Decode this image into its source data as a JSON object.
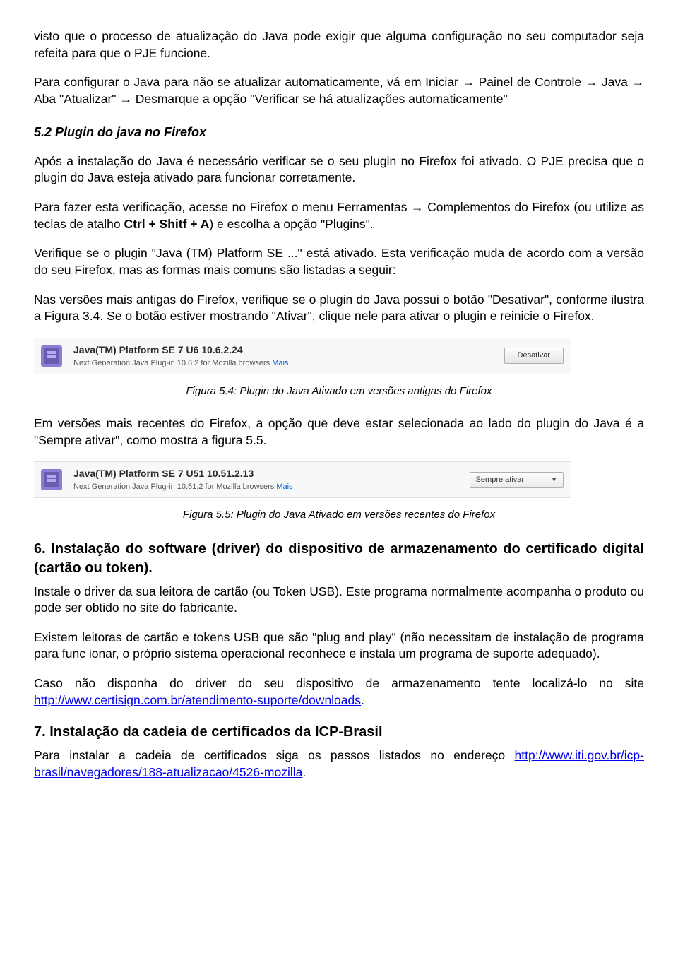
{
  "para1": "visto que o processo de atualização do Java pode exigir que alguma configuração no seu computador seja refeita para que o PJE funcione.",
  "para2": "Para configurar o Java para não se atualizar automaticamente, vá em Iniciar → Painel de Controle → Java → Aba \"Atualizar\" → Desmarque a opção \"Verificar se há atualizações automaticamente\"",
  "heading52": "5.2 Plugin do java no Firefox",
  "para3": "Após a instalação do Java é necessário verificar se o seu plugin no Firefox foi ativado. O PJE precisa que o plugin do Java esteja ativado para funcionar corretamente.",
  "para4_a": "Para fazer esta verificação, acesse no Firefox o menu Ferramentas → Complementos do Firefox (ou utilize as teclas de atalho ",
  "para4_b": "Ctrl + Shitf + A",
  "para4_c": ") e escolha a opção \"Plugins\".",
  "para5": "Verifique se o plugin \"Java (TM) Platform SE ...\" está ativado. Esta verificação muda de acordo com a versão do seu Firefox, mas as formas mais comuns são listadas a seguir:",
  "para6": "Nas versões mais antigas do Firefox, verifique se o plugin do Java possui o botão \"Desativar\", conforme ilustra a Figura 3.4. Se o botão estiver mostrando \"Ativar\", clique nele para ativar o plugin e reinicie o Firefox.",
  "plugin1": {
    "title": "Java(TM) Platform SE 7 U6  10.6.2.24",
    "sub": "Next Generation Java Plug-in 10.6.2 for Mozilla browsers  ",
    "more": "Mais",
    "button": "Desativar"
  },
  "caption54": "Figura 5.4: Plugin do Java Ativado em versões antigas do Firefox",
  "para7": "Em versões mais recentes do Firefox, a opção que deve estar selecionada ao lado do plugin do Java é a \"Sempre ativar\", como mostra a figura 5.5.",
  "plugin2": {
    "title": "Java(TM) Platform SE 7 U51  10.51.2.13",
    "sub": "Next Generation Java Plug-in 10.51.2 for Mozilla browsers  ",
    "more": "Mais",
    "select": "Sempre ativar"
  },
  "caption55": "Figura 5.5: Plugin do Java Ativado em versões recentes do Firefox",
  "heading6": "6.    Instalação do software (driver) do dispositivo de armazenamento do certificado digital (cartão ou token).",
  "para8": "Instale o driver da sua leitora de cartão (ou Token USB). Este programa normalmente acompanha o produto ou pode ser obtido no site do fabricante.",
  "para9": "Existem leitoras de cartão e tokens USB que são \"plug and play\" (não necessitam de instalação de programa para func ionar, o próprio sistema operacional reconhece e instala um programa de suporte adequado).",
  "para10_a": "Caso não disponha do driver do seu dispositivo de armazenamento tente localizá-lo no site ",
  "para10_link": "http://www.certisign.com.br/atendimento-suporte/downloads",
  "para10_b": ".",
  "heading7": "7.    Instalação da cadeia de certificados da ICP-Brasil",
  "para11_a": "Para instalar a cadeia de certificados siga os passos listados no endereço ",
  "para11_link": "http://www.iti.gov.br/icp-brasil/navegadores/188-atualizacao/4526-mozilla",
  "para11_b": "."
}
